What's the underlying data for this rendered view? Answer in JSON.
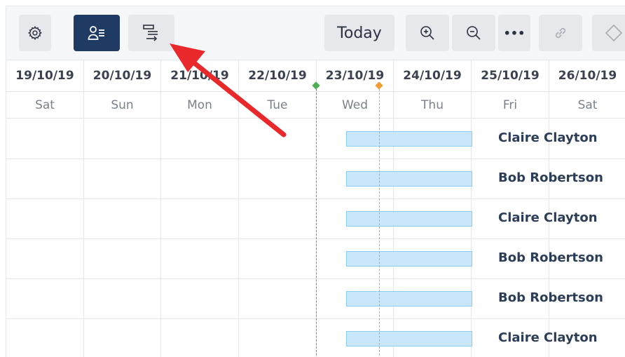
{
  "toolbar": {
    "settings_icon": "gear-icon",
    "resource_view_icon": "user-list-icon",
    "gantt_view_icon": "gantt-structure-icon",
    "today_label": "Today",
    "zoom_in_icon": "zoom-in-icon",
    "zoom_out_icon": "zoom-out-icon",
    "more_label": "•••",
    "link_icon": "link-icon",
    "milestone_icon": "diamond-icon"
  },
  "timeline": {
    "dates": [
      "19/10/19",
      "20/10/19",
      "21/10/19",
      "22/10/19",
      "23/10/19",
      "24/10/19",
      "25/10/19",
      "26/10/19"
    ],
    "days": [
      "Sat",
      "Sun",
      "Mon",
      "Tue",
      "Wed",
      "Thu",
      "Fri",
      "Sat"
    ]
  },
  "rows": [
    {
      "assignee": "Claire Clayton"
    },
    {
      "assignee": "Bob Robertson"
    },
    {
      "assignee": "Claire Clayton"
    },
    {
      "assignee": "Bob Robertson"
    },
    {
      "assignee": "Bob Robertson"
    },
    {
      "assignee": "Claire Clayton"
    }
  ],
  "colors": {
    "accent": "#1f3b63",
    "bar_fill": "#c8e7fb",
    "today_marker": "#4caf50",
    "other_marker": "#f39c34",
    "annotation_arrow": "#e8282a"
  }
}
